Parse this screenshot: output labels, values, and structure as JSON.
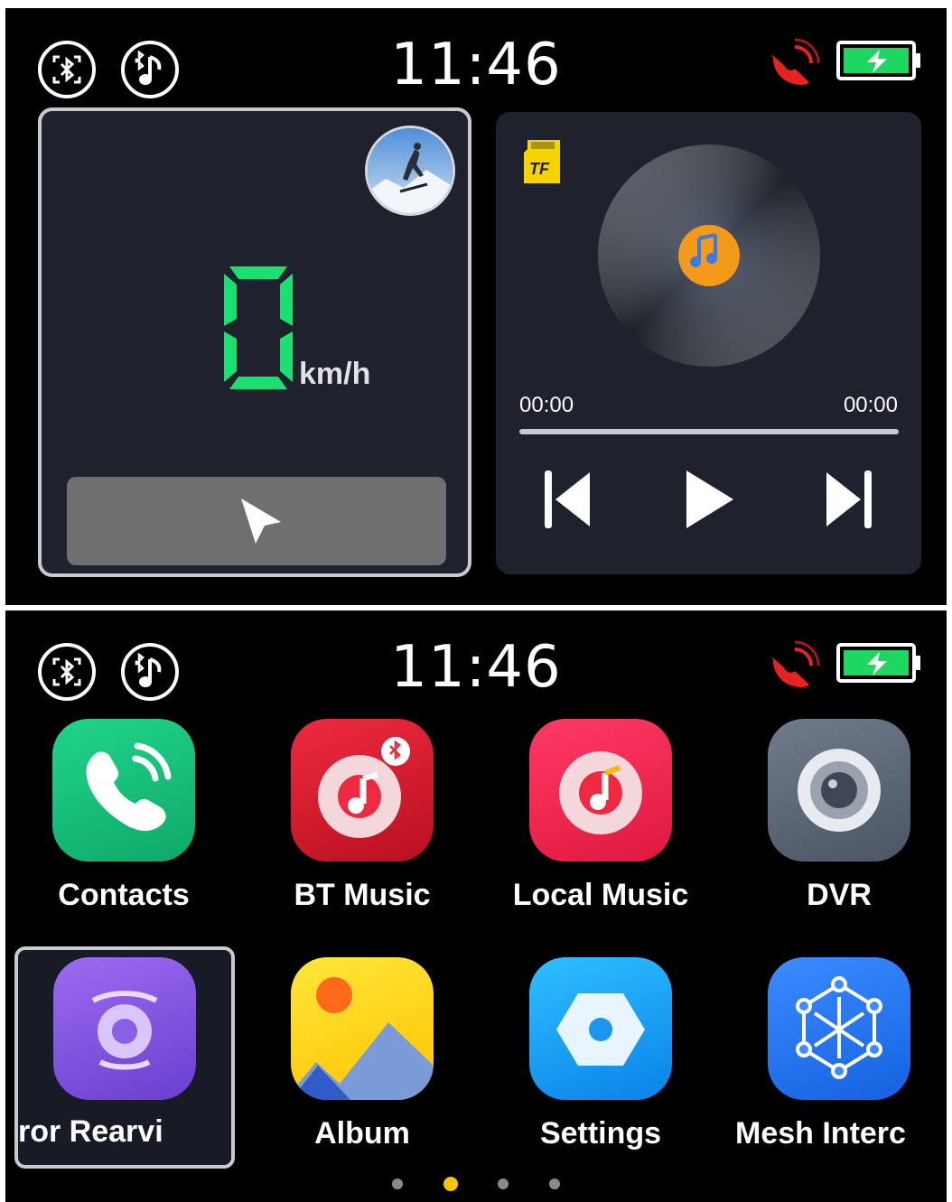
{
  "status": {
    "time": "11:46",
    "icons": [
      "bluetooth-scan-icon",
      "bluetooth-music-icon",
      "signal-icon",
      "battery-charging-icon"
    ],
    "battery_color": "#1ed760",
    "signal_color": "#e8231f"
  },
  "home": {
    "speed": {
      "value": "0",
      "unit": "km/h",
      "digit_color": "#19e070",
      "avatar_icon": "snowboarder-avatar-icon",
      "nav_icon": "navigation-arrow-icon"
    },
    "music": {
      "source_icon": "tf-card-icon",
      "source_label": "TF",
      "elapsed": "00:00",
      "duration": "00:00",
      "progress": 0,
      "controls": [
        "previous-icon",
        "play-icon",
        "next-icon"
      ]
    }
  },
  "apps": {
    "page": 1,
    "page_count": 4,
    "items": [
      {
        "label": "Contacts",
        "icon": "phone-icon"
      },
      {
        "label": "BT Music",
        "icon": "bt-music-icon"
      },
      {
        "label": "Local Music",
        "icon": "local-music-icon"
      },
      {
        "label": "DVR",
        "icon": "camera-lens-icon"
      },
      {
        "label": "ror       Rearvi",
        "icon": "rearview-camera-icon"
      },
      {
        "label": "Album",
        "icon": "album-icon"
      },
      {
        "label": "Settings",
        "icon": "settings-icon"
      },
      {
        "label": "Mesh Interc",
        "icon": "mesh-intercom-icon"
      }
    ]
  }
}
